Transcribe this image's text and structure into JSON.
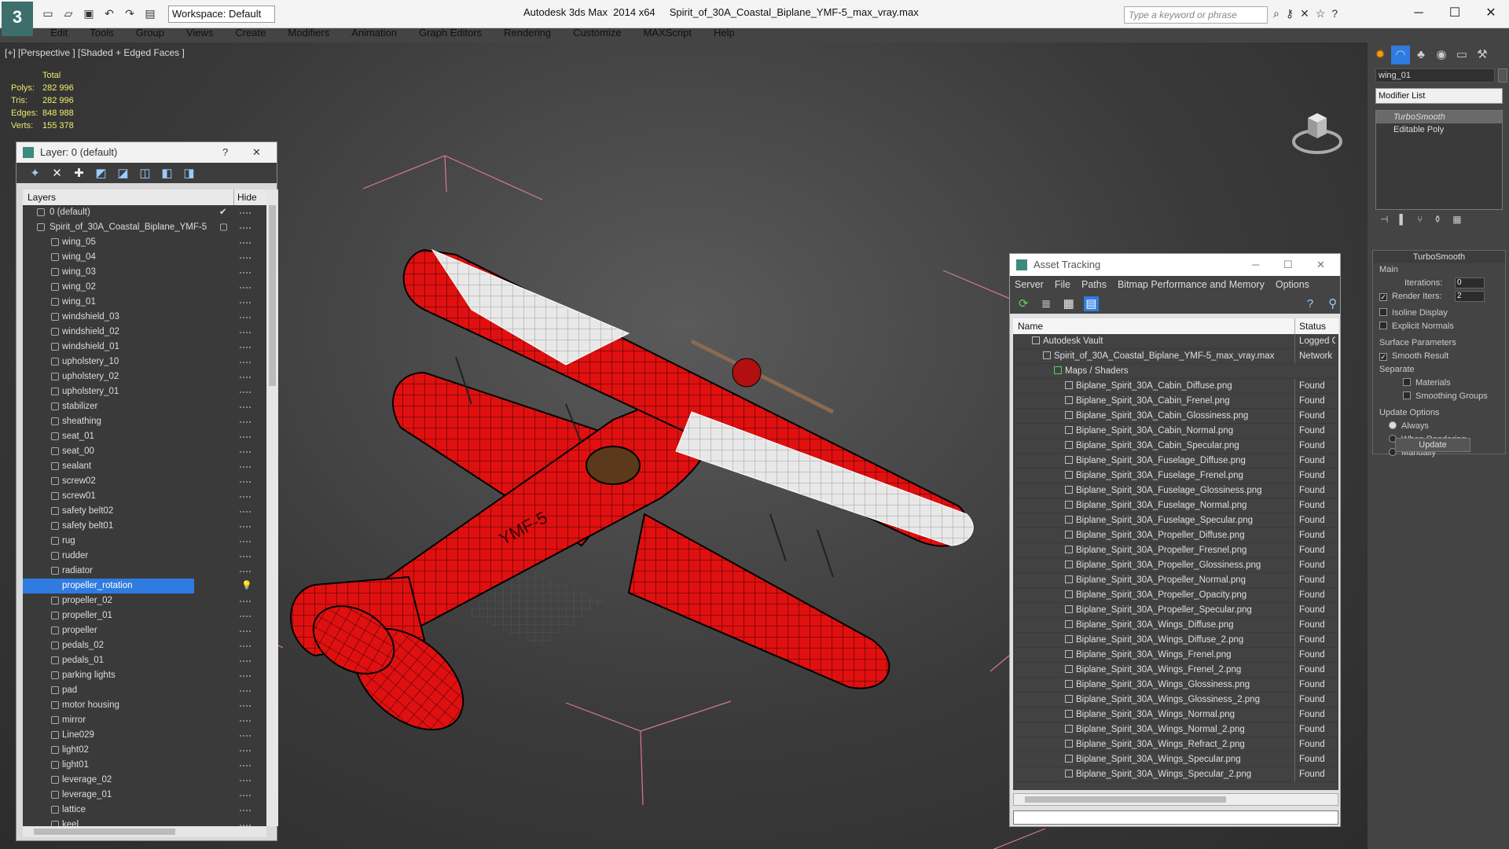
{
  "app": {
    "title": "Autodesk 3ds Max  2014 x64",
    "file": "Spirit_of_30A_Coastal_Biplane_YMF-5_max_vray.max",
    "workspace": "Workspace: Default",
    "search_placeholder": "Type a keyword or phrase",
    "logo": "3"
  },
  "menu": [
    "Edit",
    "Tools",
    "Group",
    "Views",
    "Create",
    "Modifiers",
    "Animation",
    "Graph Editors",
    "Rendering",
    "Customize",
    "MAXScript",
    "Help"
  ],
  "viewport": {
    "label": "[+] [Perspective ] [Shaded + Edged Faces ]",
    "stats_header": "Total",
    "stats": [
      {
        "k": "Polys:",
        "v": "282 996"
      },
      {
        "k": "Tris:",
        "v": "282 996"
      },
      {
        "k": "Edges:",
        "v": "848 988"
      },
      {
        "k": "Verts:",
        "v": "155 378"
      }
    ],
    "decal": "YMF-5",
    "colors": {
      "plane": "#e01010",
      "wire": "#000000",
      "highlight_wire": "#ffffff",
      "bbox": "#d87a90"
    }
  },
  "layer_window": {
    "title": "Layer: 0 (default)",
    "help": "?",
    "close": "✕",
    "col_layers": "Layers",
    "col_hide": "Hide",
    "top_rows": [
      {
        "name": "0 (default)",
        "check": "✔"
      },
      {
        "name": "Spirit_of_30A_Coastal_Biplane_YMF-5",
        "check": "▢"
      }
    ],
    "rows": [
      "wing_05",
      "wing_04",
      "wing_03",
      "wing_02",
      "wing_01",
      "windshield_03",
      "windshield_02",
      "windshield_01",
      "upholstery_10",
      "upholstery_02",
      "upholstery_01",
      "stabilizer",
      "sheathing",
      "seat_01",
      "seat_00",
      "sealant",
      "screw02",
      "screw01",
      "safety belt02",
      "safety belt01",
      "rug",
      "rudder",
      "radiator",
      "propeller_rotation",
      "propeller_02",
      "propeller_01",
      "propeller",
      "pedals_02",
      "pedals_01",
      "parking lights",
      "pad",
      "motor housing",
      "mirror",
      "Line029",
      "light02",
      "light01",
      "leverage_02",
      "leverage_01",
      "lattice",
      "keel"
    ],
    "selected": "propeller_rotation"
  },
  "asset_tracking": {
    "title": "Asset Tracking",
    "menu": [
      "Server",
      "File",
      "Paths",
      "Bitmap Performance and Memory",
      "Options"
    ],
    "col_name": "Name",
    "col_status": "Status",
    "vault": {
      "name": "Autodesk Vault",
      "status": "Logged O"
    },
    "file": {
      "name": "Spirit_of_30A_Coastal_Biplane_YMF-5_max_vray.max",
      "status": "Network F"
    },
    "group": "Maps / Shaders",
    "maps": [
      "Biplane_Spirit_30A_Cabin_Diffuse.png",
      "Biplane_Spirit_30A_Cabin_Frenel.png",
      "Biplane_Spirit_30A_Cabin_Glossiness.png",
      "Biplane_Spirit_30A_Cabin_Normal.png",
      "Biplane_Spirit_30A_Cabin_Specular.png",
      "Biplane_Spirit_30A_Fuselage_Diffuse.png",
      "Biplane_Spirit_30A_Fuselage_Frenel.png",
      "Biplane_Spirit_30A_Fuselage_Glossiness.png",
      "Biplane_Spirit_30A_Fuselage_Normal.png",
      "Biplane_Spirit_30A_Fuselage_Specular.png",
      "Biplane_Spirit_30A_Propeller_Diffuse.png",
      "Biplane_Spirit_30A_Propeller_Fresnel.png",
      "Biplane_Spirit_30A_Propeller_Glossiness.png",
      "Biplane_Spirit_30A_Propeller_Normal.png",
      "Biplane_Spirit_30A_Propeller_Opacity.png",
      "Biplane_Spirit_30A_Propeller_Specular.png",
      "Biplane_Spirit_30A_Wings_Diffuse.png",
      "Biplane_Spirit_30A_Wings_Diffuse_2.png",
      "Biplane_Spirit_30A_Wings_Frenel.png",
      "Biplane_Spirit_30A_Wings_Frenel_2.png",
      "Biplane_Spirit_30A_Wings_Glossiness.png",
      "Biplane_Spirit_30A_Wings_Glossiness_2.png",
      "Biplane_Spirit_30A_Wings_Normal.png",
      "Biplane_Spirit_30A_Wings_Normal_2.png",
      "Biplane_Spirit_30A_Wings_Refract_2.png",
      "Biplane_Spirit_30A_Wings_Specular.png",
      "Biplane_Spirit_30A_Wings_Specular_2.png"
    ],
    "map_status": "Found"
  },
  "command_panel": {
    "object_name": "wing_01",
    "modifier_list": "Modifier List",
    "stack": [
      "TurboSmooth",
      "Editable Poly"
    ],
    "turbosmooth": {
      "title": "TurboSmooth",
      "main": "Main",
      "iterations_label": "Iterations:",
      "iterations": "0",
      "render_iters_label": "Render Iters:",
      "render_iters": "2",
      "isoline": "Isoline Display",
      "explicit": "Explicit Normals",
      "surface": "Surface Parameters",
      "smooth_result": "Smooth Result",
      "separate": "Separate",
      "materials": "Materials",
      "smoothing_groups": "Smoothing Groups",
      "update_options": "Update Options",
      "always": "Always",
      "when_rendering": "When Rendering",
      "manually": "Manually",
      "update": "Update"
    }
  }
}
